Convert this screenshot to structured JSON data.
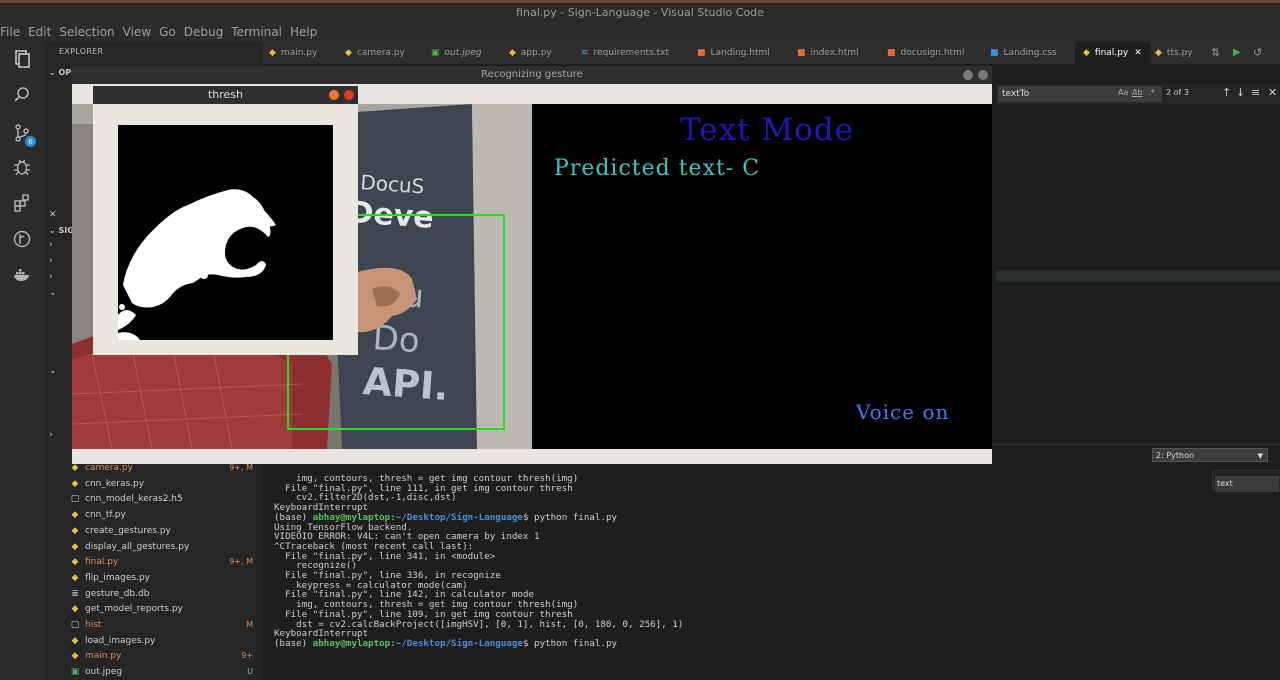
{
  "window": {
    "title": "final.py - Sign-Language - Visual Studio Code"
  },
  "menu": [
    "File",
    "Edit",
    "Selection",
    "View",
    "Go",
    "Debug",
    "Terminal",
    "Help"
  ],
  "sidebar": {
    "explorer_title": "EXPLORER",
    "open_editors_label": "OPE",
    "project_label": "SIG",
    "files": [
      {
        "name": "camera.py",
        "icon": "python-icon",
        "status": "9+, M",
        "modified": true
      },
      {
        "name": "cnn_keras.py",
        "icon": "python-icon",
        "status": "",
        "modified": false
      },
      {
        "name": "cnn_model_keras2.h5",
        "icon": "file-icon",
        "status": "",
        "modified": false
      },
      {
        "name": "cnn_tf.py",
        "icon": "python-icon",
        "status": "",
        "modified": false
      },
      {
        "name": "create_gestures.py",
        "icon": "python-icon",
        "status": "",
        "modified": false
      },
      {
        "name": "display_all_gestures.py",
        "icon": "python-icon",
        "status": "",
        "modified": false
      },
      {
        "name": "final.py",
        "icon": "python-icon",
        "status": "9+, M",
        "modified": true
      },
      {
        "name": "flip_images.py",
        "icon": "python-icon",
        "status": "",
        "modified": false
      },
      {
        "name": "gesture_db.db",
        "icon": "database-icon",
        "status": "",
        "modified": false
      },
      {
        "name": "get_model_reports.py",
        "icon": "python-icon",
        "status": "",
        "modified": false
      },
      {
        "name": "hist",
        "icon": "file-icon",
        "status": "M",
        "modified": true
      },
      {
        "name": "load_images.py",
        "icon": "python-icon",
        "status": "",
        "modified": false
      },
      {
        "name": "main.py",
        "icon": "python-icon",
        "status": "9+",
        "modified": true
      },
      {
        "name": "out.jpeg",
        "icon": "image-icon",
        "status": "U",
        "modified": false
      }
    ]
  },
  "tabs": [
    {
      "label": "main.py",
      "icon": "python-icon"
    },
    {
      "label": "camera.py",
      "icon": "python-icon"
    },
    {
      "label": "out.jpeg",
      "icon": "image-icon"
    },
    {
      "label": "app.py",
      "icon": "python-icon"
    },
    {
      "label": "requirements.txt",
      "icon": "text-icon"
    },
    {
      "label": "Landing.html",
      "icon": "html-icon"
    },
    {
      "label": "index.html",
      "icon": "html-icon"
    },
    {
      "label": "docusign.html",
      "icon": "html-icon"
    },
    {
      "label": "Landing.css",
      "icon": "css-icon"
    },
    {
      "label": "final.py",
      "icon": "python-icon",
      "active": true
    },
    {
      "label": "tts.py",
      "icon": "python-icon"
    }
  ],
  "find": {
    "value": "textTo",
    "count": "2 of 3",
    "match_case": "Aa",
    "whole_word": "Ab",
    "regex": ".*"
  },
  "terminal": {
    "selector": "2: Python",
    "find_value": "text",
    "lines": [
      "    img, contours, thresh = get img contour thresh(img)",
      "  File \"final.py\", line 111, in get img contour thresh",
      "    cv2.filter2D(dst,-1,disc,dst)",
      "KeyboardInterrupt",
      {
        "prefix": "(base) ",
        "user": "abhay@mylaptop",
        "sep": ":",
        "path": "~/Desktop/Sign-Language",
        "cmd": "$ python final.py"
      },
      "Using TensorFlow backend.",
      "VIDEOIO ERROR: V4L: can't open camera by index 1",
      "^CTraceback (most recent call last):",
      "  File \"final.py\", line 341, in <module>",
      "    recognize()",
      "  File \"final.py\", line 336, in recognize",
      "    keypress = calculator mode(cam)",
      "  File \"final.py\", line 142, in calculator mode",
      "    img, contours, thresh = get img contour thresh(img)",
      "  File \"final.py\", line 109, in get img contour thresh",
      "    dst = cv2.calcBackProject([imgHSV], [0, 1], hist, [0, 180, 0, 256], 1)",
      "KeyboardInterrupt",
      {
        "prefix": "(base) ",
        "user": "abhay@mylaptop",
        "sep": ":",
        "path": "~/Desktop/Sign-Language",
        "cmd": "$ python final.py"
      }
    ]
  },
  "gesture_window": {
    "title": "Recognizing gesture",
    "mode_text": "Text Mode",
    "predicted_text": "Predicted text- C",
    "voice_text": "Voice on"
  },
  "thresh_window": {
    "title": "thresh"
  },
  "colors": {
    "accent": "#2a8ade",
    "mode_text": "#1a1ab8",
    "predicted_text": "#37c8c5",
    "voice_text": "#3b7cf0",
    "roi_box": "#22dd22"
  }
}
